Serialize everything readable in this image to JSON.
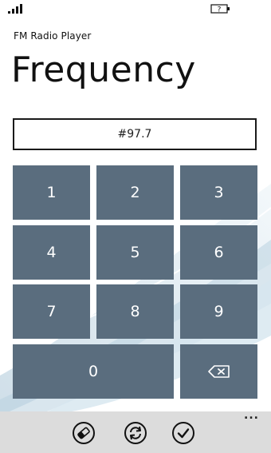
{
  "status_bar": {
    "signal_icon": "signal-strength-icon",
    "battery_icon": "battery-unknown-icon",
    "battery_glyph": "?"
  },
  "app": {
    "title": "FM Radio Player",
    "page_title": "Frequency"
  },
  "frequency_input": {
    "value": "#97.7"
  },
  "keypad": {
    "keys": [
      "1",
      "2",
      "3",
      "4",
      "5",
      "6",
      "7",
      "8",
      "9",
      "0"
    ],
    "backspace_icon": "backspace-icon"
  },
  "app_bar": {
    "buttons": [
      "eraser-icon",
      "refresh-icon",
      "check-icon"
    ],
    "more": "..."
  },
  "colors": {
    "key_background": "#5a6d7e",
    "app_bar_background": "#dcdcdc",
    "text": "#111111"
  }
}
